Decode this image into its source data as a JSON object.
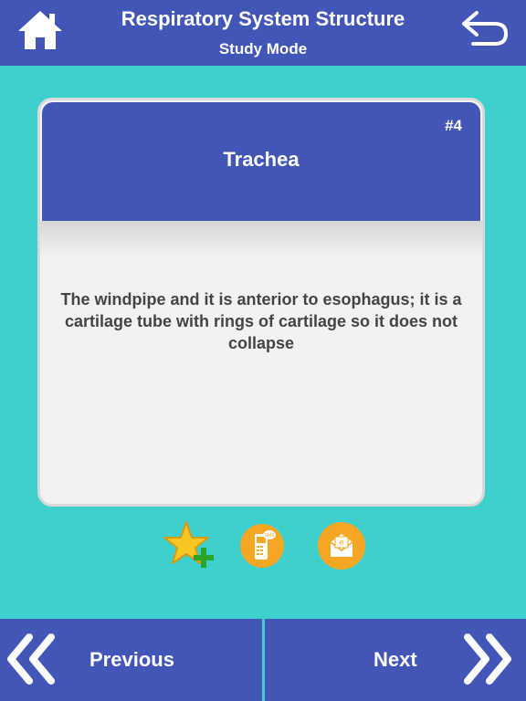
{
  "header": {
    "title": "Respiratory System Structure",
    "subtitle": "Study Mode",
    "home_icon": "home-icon",
    "back_icon": "back-arrow-icon"
  },
  "card": {
    "number": "#4",
    "term": "Trachea",
    "definition": "The windpipe and it is anterior to esophagus; it is a cartilage tube with rings of cartilage so it does not collapse"
  },
  "actions": {
    "favorite_icon": "star-add-icon",
    "sms_icon": "sms-phone-icon",
    "email_icon": "email-icon",
    "sms_label": "SMS",
    "email_label": "e"
  },
  "footer": {
    "previous_label": "Previous",
    "next_label": "Next"
  },
  "colors": {
    "background": "#3ecfcf",
    "primary": "#4156b7",
    "accent": "#f5a623",
    "card_bg": "#f2f2f2"
  }
}
